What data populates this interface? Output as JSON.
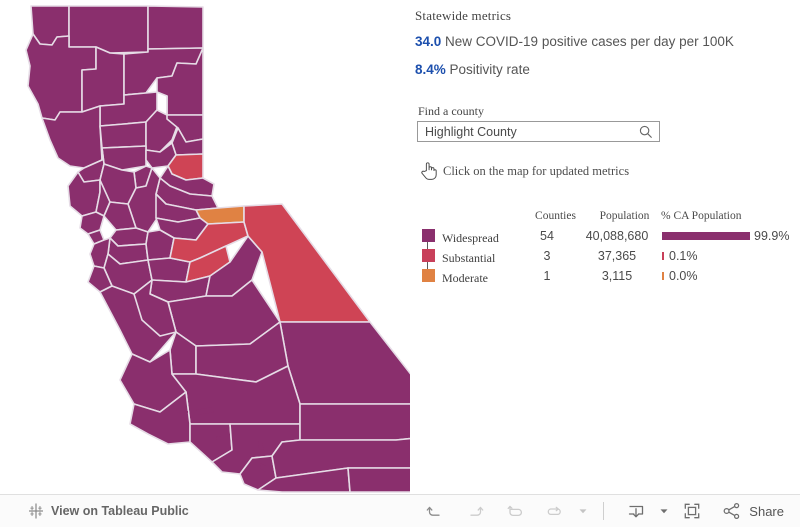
{
  "panel": {
    "statewide_title": "Statewide metrics",
    "metrics": [
      {
        "value": "34.0",
        "label": "New COVID-19 positive cases per day per 100K"
      },
      {
        "value": "8.4%",
        "label": "Positivity rate"
      }
    ],
    "find_county_label": "Find a county",
    "search": {
      "value": "Highlight County",
      "placeholder": "Highlight County",
      "icon": "search-icon"
    },
    "click_hint": {
      "icon": "pointing-hand-icon",
      "text": "Click on the map for updated metrics"
    }
  },
  "legend": {
    "headers": {
      "tier": "",
      "counties": "Counties",
      "population": "Population",
      "pct": "% CA Population"
    },
    "rows": [
      {
        "tier": "Widespread",
        "color": "#8a2f6d",
        "counties": "54",
        "population": "40,088,680",
        "pct_label": "99.9%",
        "pct_value": 99.9
      },
      {
        "tier": "Substantial",
        "color": "#c8405a",
        "counties": "3",
        "population": "37,365",
        "pct_label": "0.1%",
        "pct_value": 0.1
      },
      {
        "tier": "Moderate",
        "color": "#e08243",
        "counties": "1",
        "population": "3,115",
        "pct_label": "0.0%",
        "pct_value": 0.0
      }
    ]
  },
  "map": {
    "colors": {
      "widespread": "#8a2f6d",
      "substantial": "#cf4455",
      "moderate": "#e08243",
      "border": "#e6dce6",
      "background": "#ffffff"
    }
  },
  "toolbar": {
    "tableau_label": "View on Tableau Public",
    "tableau_icon": "tableau-logo-icon",
    "buttons": [
      {
        "name": "undo-button",
        "icon": "undo-icon",
        "enabled": true
      },
      {
        "name": "redo-button",
        "icon": "redo-icon",
        "enabled": false
      },
      {
        "name": "revert-button",
        "icon": "revert-icon",
        "enabled": false
      },
      {
        "name": "refresh-button",
        "icon": "refresh-icon",
        "enabled": false
      }
    ],
    "download_icon": "download-icon",
    "fullscreen_icon": "fullscreen-icon",
    "share_icon": "share-icon",
    "share_label": "Share"
  },
  "chart_data": {
    "type": "map",
    "title": "California COVID-19 transmission tiers by county",
    "legend_position": "right",
    "categories": [
      "Widespread",
      "Substantial",
      "Moderate"
    ],
    "series": [
      {
        "name": "Counties",
        "values": [
          54,
          3,
          1
        ]
      },
      {
        "name": "Population",
        "values": [
          40088680,
          37365,
          3115
        ]
      },
      {
        "name": "% CA Population",
        "values": [
          99.9,
          0.1,
          0.0
        ]
      }
    ],
    "statewide": {
      "new_cases_per_day_per_100k": 34.0,
      "positivity_rate_pct": 8.4
    }
  }
}
